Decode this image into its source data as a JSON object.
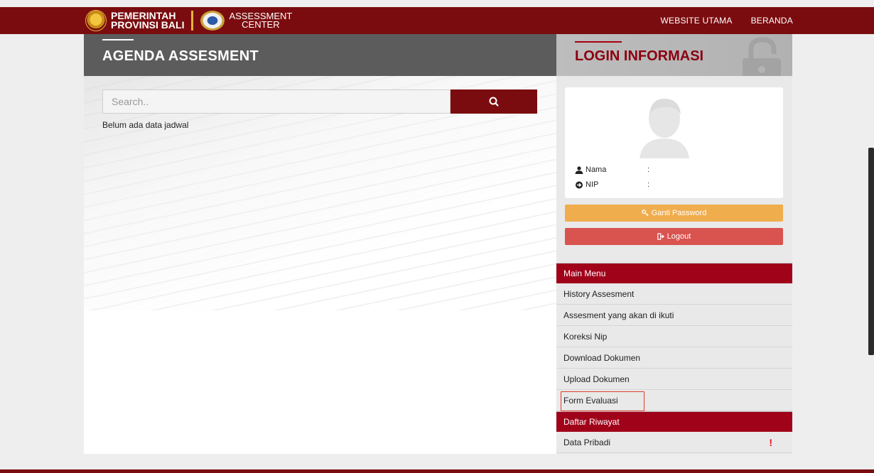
{
  "brand": {
    "line1": "PEMERINTAH",
    "line2": "PROVINSI BALI",
    "center_line1": "ASSESSMENT",
    "center_line2": "CENTER"
  },
  "nav": {
    "website_utama": "WEBSITE UTAMA",
    "beranda": "BERANDA"
  },
  "agenda": {
    "title": "AGENDA ASSESMENT",
    "search_placeholder": "Search..",
    "empty_message": "Belum ada data jadwal"
  },
  "login": {
    "title": "LOGIN INFORMASI",
    "nama_label": "Nama",
    "nip_label": "NIP",
    "separator": ":",
    "ganti_password": "Ganti Password",
    "logout": "Logout"
  },
  "menu": {
    "main_header": "Main Menu",
    "items": [
      {
        "label": "History Assesment"
      },
      {
        "label": "Assesment yang akan di ikuti"
      },
      {
        "label": "Koreksi Nip"
      },
      {
        "label": "Download Dokumen"
      },
      {
        "label": "Upload Dokumen"
      },
      {
        "label": "Form Evaluasi"
      }
    ],
    "riwayat_header": "Daftar Riwayat",
    "riwayat_items": [
      {
        "label": "Data Pribadi",
        "alert": "!"
      }
    ]
  },
  "colors": {
    "brand": "#7a0c0f",
    "menu_header": "#a0021a",
    "password_button": "#f0ad4e",
    "logout_button": "#d9534f",
    "highlight_border": "#e33a2b"
  }
}
